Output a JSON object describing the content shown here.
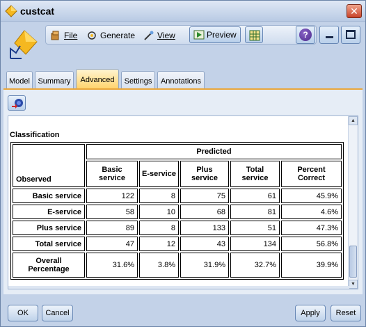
{
  "window": {
    "title": "custcat"
  },
  "toolbar": {
    "file_label": "File",
    "generate_label": "Generate",
    "view_label": "View",
    "preview_label": "Preview"
  },
  "tabs": [
    {
      "label": "Model"
    },
    {
      "label": "Summary"
    },
    {
      "label": "Advanced"
    },
    {
      "label": "Settings"
    },
    {
      "label": "Annotations"
    }
  ],
  "active_tab": "Advanced",
  "content": {
    "section_title": "Classification",
    "header": {
      "observed": "Observed",
      "predicted": "Predicted",
      "columns": [
        "Basic service",
        "E-service",
        "Plus service",
        "Total service",
        "Percent Correct"
      ]
    },
    "rows": [
      {
        "label": "Basic service",
        "values": [
          "122",
          "8",
          "75",
          "61",
          "45.9%"
        ]
      },
      {
        "label": "E-service",
        "values": [
          "58",
          "10",
          "68",
          "81",
          "4.6%"
        ]
      },
      {
        "label": "Plus service",
        "values": [
          "89",
          "8",
          "133",
          "51",
          "47.3%"
        ]
      },
      {
        "label": "Total service",
        "values": [
          "47",
          "12",
          "43",
          "134",
          "56.8%"
        ]
      },
      {
        "label": "Overall Percentage",
        "values": [
          "31.6%",
          "3.8%",
          "31.9%",
          "32.7%",
          "39.9%"
        ]
      }
    ]
  },
  "footer": {
    "ok_label": "OK",
    "cancel_label": "Cancel",
    "apply_label": "Apply",
    "reset_label": "Reset"
  },
  "colors": {
    "window_bg": "#c3d2e8",
    "active_tab": "#ffd36b",
    "accent_line": "#e9a63a"
  }
}
